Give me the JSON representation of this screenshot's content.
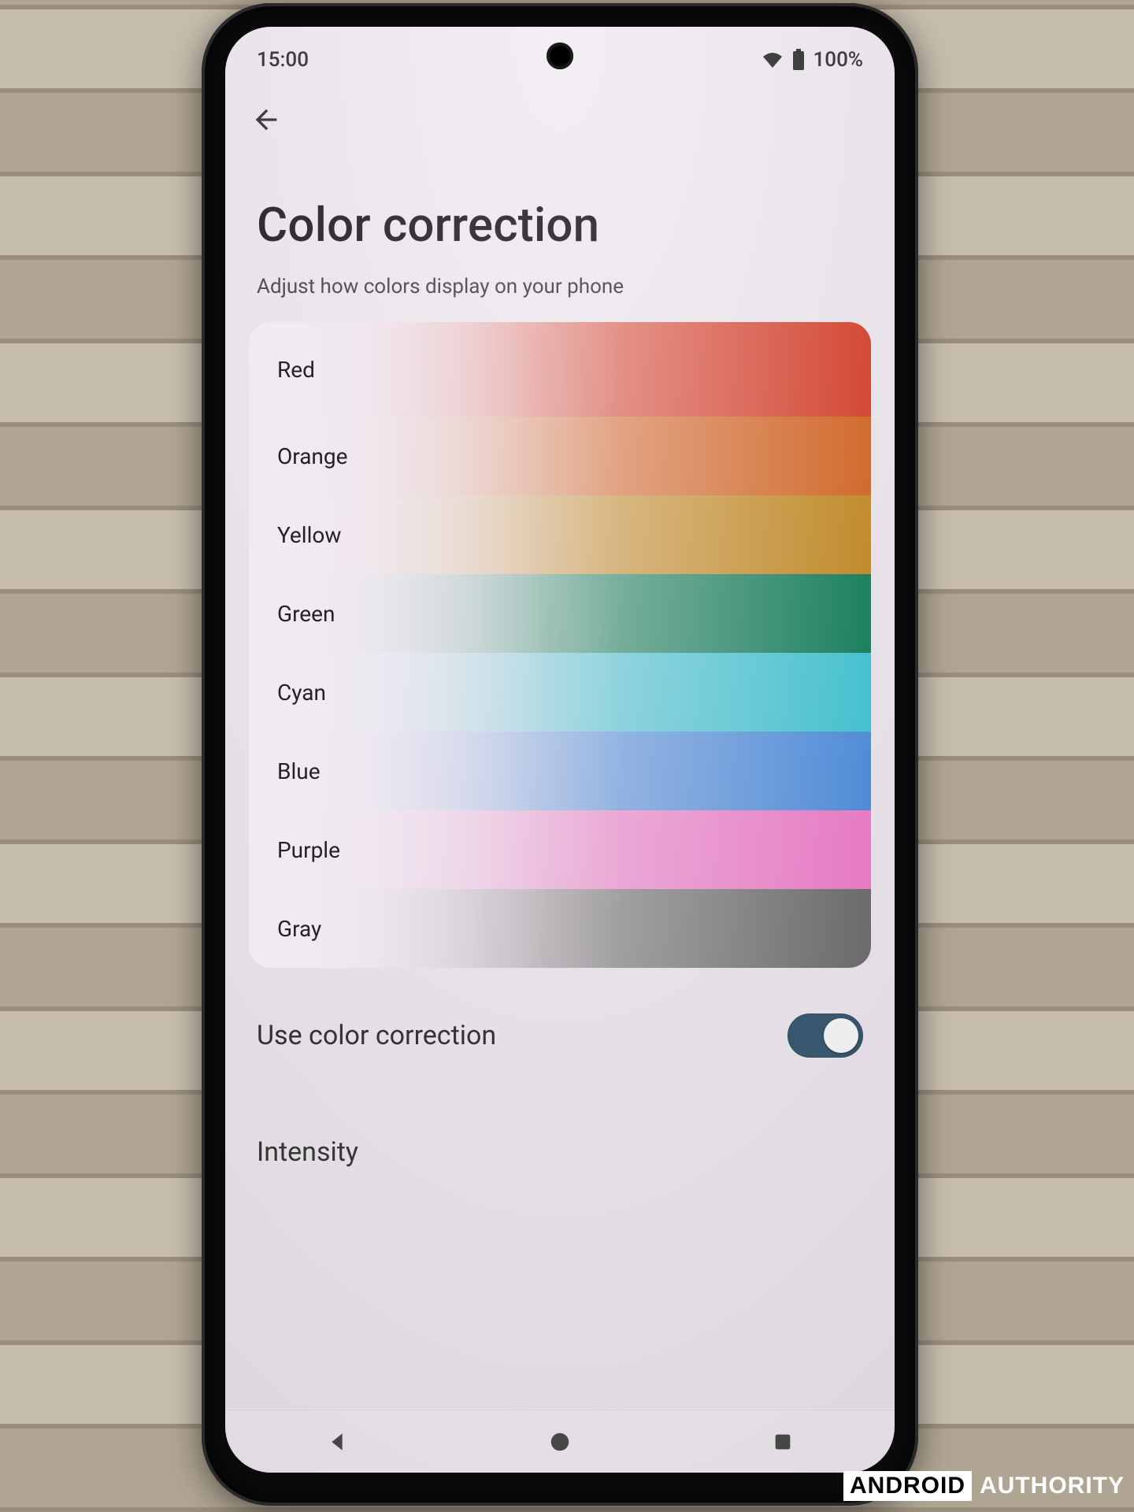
{
  "statusbar": {
    "time": "15:00",
    "battery_pct": "100%"
  },
  "header": {
    "title": "Color correction",
    "subtitle": "Adjust how colors display on your phone"
  },
  "swatches": [
    {
      "label": "Red",
      "color": "#d93d26"
    },
    {
      "label": "Orange",
      "color": "#d7641f"
    },
    {
      "label": "Yellow",
      "color": "#c58a1e"
    },
    {
      "label": "Green",
      "color": "#0e7e58"
    },
    {
      "label": "Cyan",
      "color": "#3ec7d6"
    },
    {
      "label": "Blue",
      "color": "#4a8de0"
    },
    {
      "label": "Purple",
      "color": "#f27acb"
    },
    {
      "label": "Gray",
      "color": "#6b6b6b"
    }
  ],
  "toggle": {
    "label": "Use color correction",
    "state": "on"
  },
  "next_section": {
    "label": "Intensity"
  },
  "watermark": {
    "brand_box": "ANDROID",
    "brand_rest": "AUTHORITY"
  }
}
